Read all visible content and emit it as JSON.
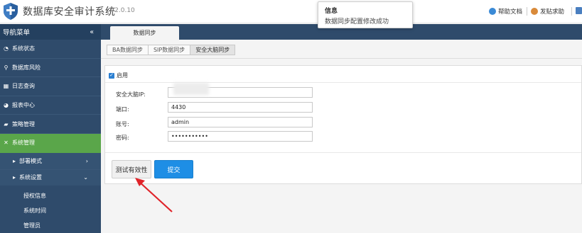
{
  "header": {
    "app_title": "数据库安全审计系统",
    "version": "V2.0.10",
    "help_label": "帮助文档",
    "post_label": "发贴求助"
  },
  "toast": {
    "title": "信息",
    "message": "数据同步配置修改成功"
  },
  "sidebar": {
    "title": "导航菜单",
    "collapse_glyph": "«",
    "items": [
      {
        "label": "系统状态",
        "icon": "dashboard-icon"
      },
      {
        "label": "数据库风险",
        "icon": "search-icon"
      },
      {
        "label": "日志查询",
        "icon": "table-icon"
      },
      {
        "label": "报表中心",
        "icon": "pie-chart-icon"
      },
      {
        "label": "策略管理",
        "icon": "book-icon"
      },
      {
        "label": "系统管理",
        "icon": "tools-icon"
      }
    ],
    "subitems": [
      {
        "label": "部署模式",
        "chevron": "›"
      },
      {
        "label": "系统设置",
        "chevron": "⌄"
      }
    ],
    "leaves": [
      "授权信息",
      "系统时间",
      "管理员"
    ]
  },
  "main_tab": "数据同步",
  "sub_tabs": [
    "BA数据同步",
    "SIP数据同步",
    "安全大脑同步"
  ],
  "form": {
    "enable_label": "启用",
    "fields": [
      {
        "label": "安全大脑IP:",
        "value": ""
      },
      {
        "label": "端口:",
        "value": "4430"
      },
      {
        "label": "账号:",
        "value": "admin"
      },
      {
        "label": "密码:",
        "value": "•••••••••••"
      }
    ],
    "test_button": "测试有效性",
    "submit_button": "提交"
  },
  "colors": {
    "sidebar_bg": "#2f4b6b",
    "active_menu": "#5aa64a",
    "primary": "#1e8ee5",
    "annotation_arrow": "#e0242a"
  }
}
